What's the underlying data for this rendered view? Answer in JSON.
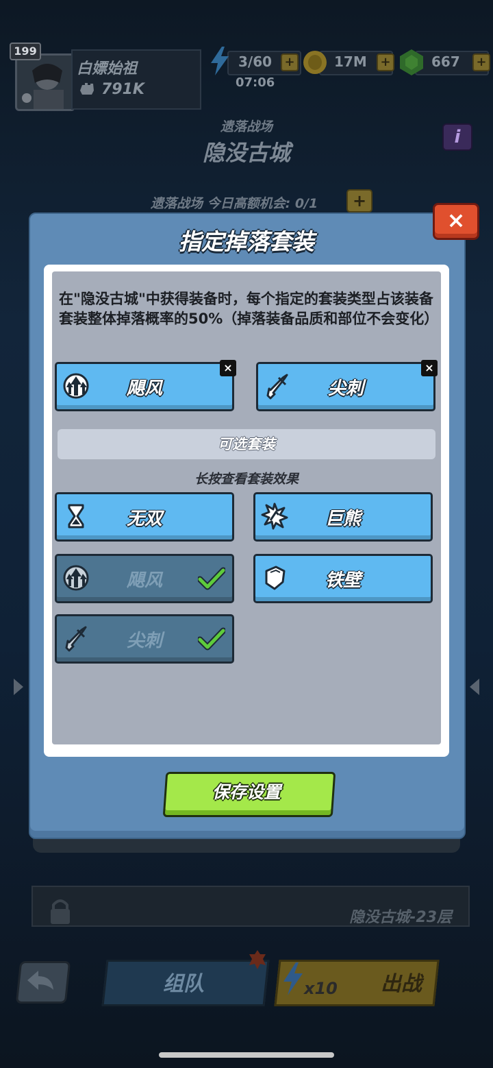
{
  "player": {
    "level": "199",
    "name": "白嫖始祖",
    "power": "791K"
  },
  "resources": {
    "energy": "3/60",
    "energy_timer": "07:06",
    "gold": "17M",
    "gems": "667"
  },
  "battlefield": {
    "subtitle": "遗落战场",
    "name": "隐没古城",
    "chance_text": "遗落战场 今日高额机会: 0/1",
    "info_label": "i"
  },
  "modal": {
    "title": "指定掉落套装",
    "close_label": "×",
    "description": "在\"隐没古城\"中获得装备时，每个指定的套装类型占该装备套装整体掉落概率的50%（掉落装备品质和部位不会变化）",
    "selected": [
      {
        "label": "飓风",
        "icon": "cyclone-icon"
      },
      {
        "label": "尖刺",
        "icon": "spike-sword-icon"
      }
    ],
    "optional_header": "可选套装",
    "hint": "长按查看套装效果",
    "options": [
      {
        "label": "无双",
        "icon": "hourglass-icon",
        "state": "available"
      },
      {
        "label": "巨熊",
        "icon": "bear-claw-icon",
        "state": "available"
      },
      {
        "label": "飓风",
        "icon": "cyclone-icon",
        "state": "selected"
      },
      {
        "label": "铁壁",
        "icon": "shield-icon",
        "state": "available"
      },
      {
        "label": "尖刺",
        "icon": "spike-sword-icon",
        "state": "selected"
      }
    ],
    "save_label": "保存设置"
  },
  "background": {
    "floor_text": "隐没古城-23层",
    "team_label": "组队",
    "fight_cost": "x10",
    "fight_label": "出战"
  },
  "colors": {
    "modal_bg": "#5f8bb6",
    "option_blue": "#5fb9f1",
    "option_dim": "#4d7591",
    "save_green": "#a4e84a",
    "close_red": "#e0502e",
    "check_green": "#5ecb3c"
  }
}
